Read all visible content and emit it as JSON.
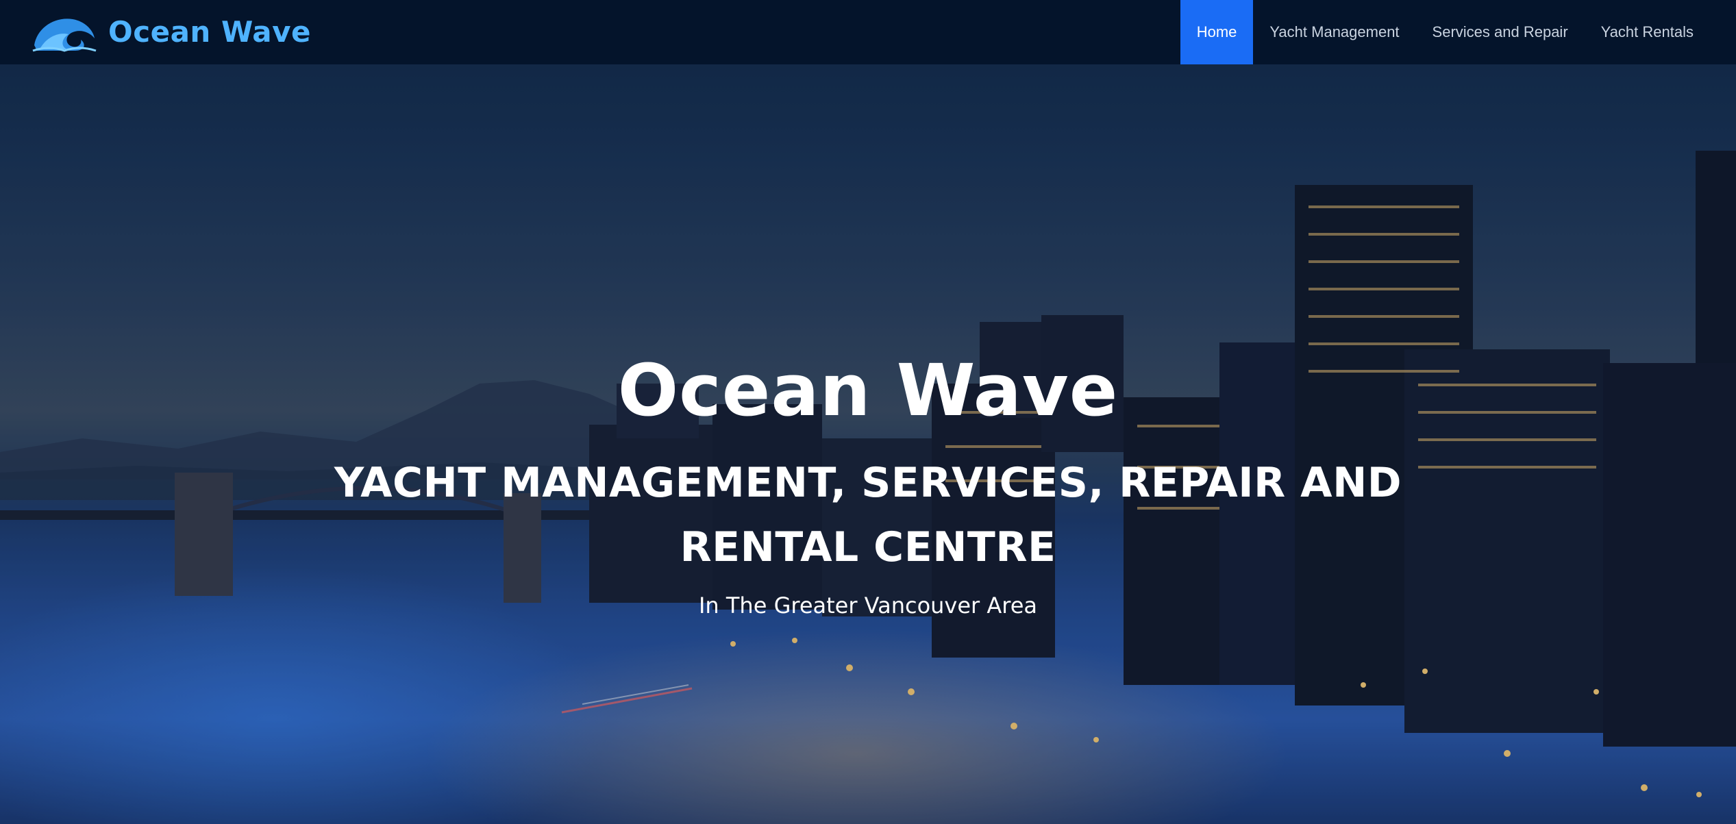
{
  "brand": {
    "name": "Ocean Wave",
    "logo_icon": "wave-icon"
  },
  "nav": {
    "items": [
      {
        "label": "Home",
        "active": true
      },
      {
        "label": "Yacht Management",
        "active": false
      },
      {
        "label": "Services and Repair",
        "active": false
      },
      {
        "label": "Yacht Rentals",
        "active": false
      }
    ]
  },
  "hero": {
    "title": "Ocean Wave",
    "subtitle": "YACHT MANAGEMENT, SERVICES, REPAIR AND RENTAL CENTRE",
    "tagline": "In The Greater Vancouver Area"
  },
  "colors": {
    "navbar_bg": "#04142b",
    "brand_text": "#4fb3ff",
    "nav_active_bg": "#1a6cf5",
    "nav_text": "#c9d3e0",
    "hero_text": "#ffffff"
  }
}
